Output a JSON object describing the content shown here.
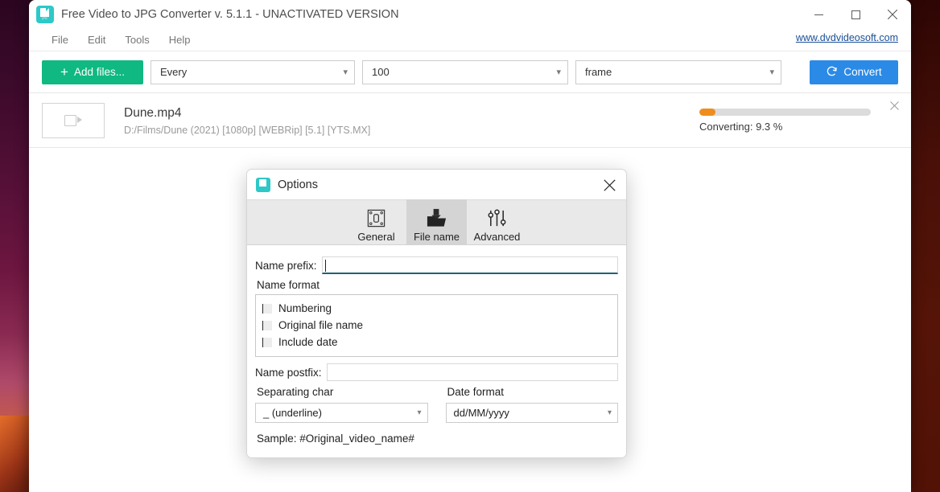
{
  "window": {
    "title": "Free Video to JPG Converter v. 5.1.1 - UNACTIVATED VERSION",
    "app_icon": "jpg-document-icon",
    "icon_label": "JPG",
    "controls": {
      "minimize": "minimize-icon",
      "maximize": "maximize-icon",
      "close": "close-icon"
    }
  },
  "menubar": {
    "items": [
      {
        "label": "File"
      },
      {
        "label": "Edit"
      },
      {
        "label": "Tools"
      },
      {
        "label": "Help"
      }
    ],
    "site_link": "www.dvdvideosoft.com"
  },
  "toolbar": {
    "add_files_label": "Add files...",
    "add_files_icon": "plus-icon",
    "mode_select": {
      "value": "Every",
      "chevron": "chevron-down-icon"
    },
    "count_select": {
      "value": "100",
      "chevron": "chevron-down-icon"
    },
    "unit_select": {
      "value": "frame",
      "chevron": "chevron-down-icon"
    },
    "convert_label": "Convert",
    "convert_icon": "refresh-icon",
    "accent_green": "#0fb981",
    "accent_blue": "#2b8ae6"
  },
  "filelist": {
    "rows": [
      {
        "thumb_icon": "video-camera-icon",
        "name": "Dune.mp4",
        "path": "D:/Films/Dune (2021) [1080p] [WEBRip] [5.1] [YTS.MX]",
        "status": "Converting: 9.3 %",
        "progress_percent": 9.3,
        "progress_color": "#ef8d1c",
        "remove_icon": "close-icon"
      }
    ]
  },
  "dialog": {
    "icon": "jpg-document-icon",
    "title": "Options",
    "close_icon": "close-icon",
    "tabs": [
      {
        "label": "General",
        "icon": "panel-screws-icon",
        "active": false
      },
      {
        "label": "File name",
        "icon": "save-to-folder-icon",
        "active": true
      },
      {
        "label": "Advanced",
        "icon": "sliders-icon",
        "active": false
      }
    ],
    "name_prefix": {
      "label": "Name prefix:",
      "value": "",
      "placeholder": "",
      "focused": true
    },
    "name_format": {
      "label": "Name format",
      "options": [
        {
          "label": "Numbering",
          "checked": false
        },
        {
          "label": "Original file name",
          "checked": false
        },
        {
          "label": "Include date",
          "checked": false
        }
      ]
    },
    "name_postfix": {
      "label": "Name postfix:",
      "value": "",
      "placeholder": ""
    },
    "separating_char": {
      "label": "Separating char",
      "value": "_ (underline)",
      "chevron": "chevron-down-icon"
    },
    "date_format": {
      "label": "Date format",
      "value": "dd/MM/yyyy",
      "chevron": "chevron-down-icon"
    },
    "sample": "Sample: #Original_video_name#"
  }
}
